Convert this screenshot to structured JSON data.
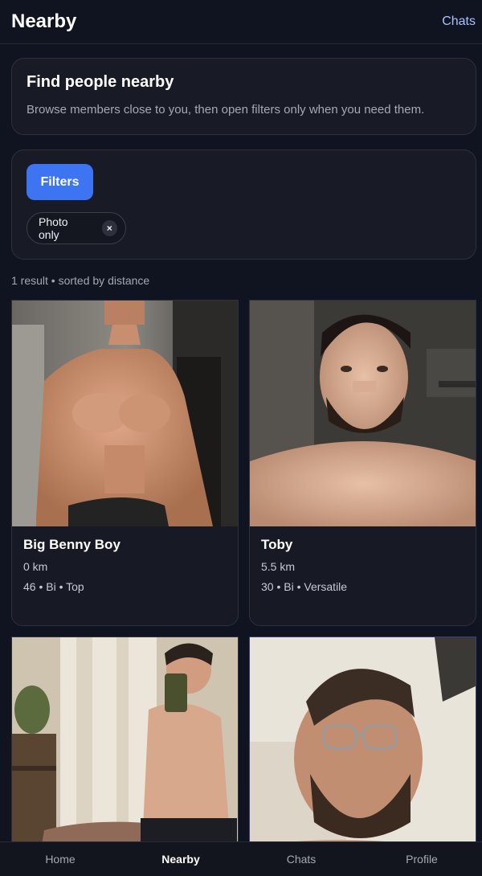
{
  "header": {
    "title": "Nearby",
    "chats_link": "Chats"
  },
  "intro": {
    "title": "Find people nearby",
    "text": "Browse members close to you, then open filters only when you need them."
  },
  "filters": {
    "button_label": "Filters",
    "active_chip": {
      "label": "Photo only",
      "remove_symbol": "×"
    }
  },
  "results": {
    "summary": "1 result • sorted by distance"
  },
  "profiles": [
    {
      "name": "Big Benny Boy",
      "distance": "0 km",
      "details": "46 • Bi • Top"
    },
    {
      "name": "Toby",
      "distance": "5.5 km",
      "details": "30 • Bi • Versatile"
    },
    {
      "name": "",
      "distance": "",
      "details": ""
    },
    {
      "name": "",
      "distance": "",
      "details": ""
    }
  ],
  "nav": {
    "items": [
      {
        "label": "Home"
      },
      {
        "label": "Nearby"
      },
      {
        "label": "Chats"
      },
      {
        "label": "Profile"
      }
    ],
    "active": "Nearby"
  },
  "colors": {
    "background": "#101320",
    "card": "#181b26",
    "accent": "#3c74f1",
    "link": "#a9c2ff"
  }
}
